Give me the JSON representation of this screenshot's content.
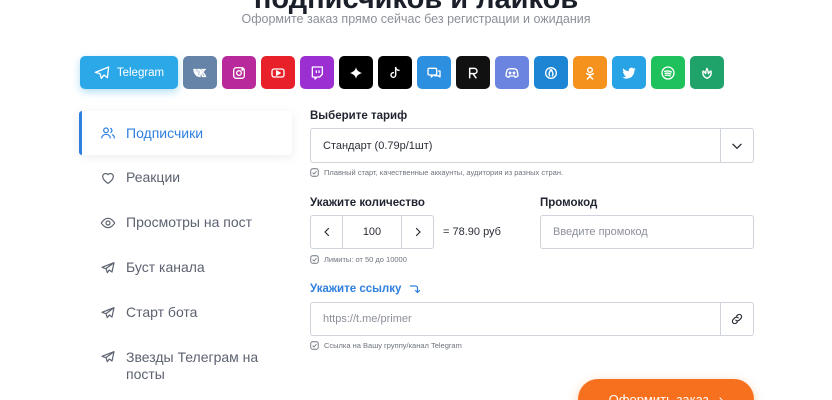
{
  "hero": {
    "title": "подписчиков и лайков",
    "subtitle": "Оформите заказ прямо сейчас без регистрации и ожидания"
  },
  "platforms": {
    "active_label": "Telegram",
    "items": [
      {
        "name": "Telegram",
        "icon": "telegram-icon",
        "color": "#2aa8e8"
      },
      {
        "name": "VK",
        "icon": "vk-icon",
        "color": "#6683a8"
      },
      {
        "name": "Instagram",
        "icon": "instagram-icon",
        "color": "#b82a9c"
      },
      {
        "name": "YouTube",
        "icon": "youtube-icon",
        "color": "#e8202a"
      },
      {
        "name": "Twitch",
        "icon": "twitch-icon",
        "color": "#9b2fd2"
      },
      {
        "name": "Threads",
        "icon": "sparkle-icon",
        "color": "#000000"
      },
      {
        "name": "TikTok",
        "icon": "tiktok-icon",
        "color": "#000000"
      },
      {
        "name": "Chat",
        "icon": "chat-icon",
        "color": "#2d8fe0"
      },
      {
        "name": "Rutube",
        "icon": "rutube-icon",
        "color": "#111111"
      },
      {
        "name": "Discord",
        "icon": "discord-icon",
        "color": "#6b84e0"
      },
      {
        "name": "Likee",
        "icon": "swirl-icon",
        "color": "#1d86d4"
      },
      {
        "name": "Odnoklassniki",
        "icon": "ok-icon",
        "color": "#f5921e"
      },
      {
        "name": "Twitter",
        "icon": "twitter-icon",
        "color": "#27a3e6"
      },
      {
        "name": "Spotify",
        "icon": "spotify-icon",
        "color": "#1ec15b"
      },
      {
        "name": "Other",
        "icon": "leaf-icon",
        "color": "#1fa36a"
      }
    ]
  },
  "sidebar": {
    "items": [
      {
        "label": "Подписчики",
        "icon": "users-icon",
        "active": true
      },
      {
        "label": "Реакции",
        "icon": "heart-icon",
        "active": false
      },
      {
        "label": "Просмотры на пост",
        "icon": "eye-icon",
        "active": false
      },
      {
        "label": "Буст канала",
        "icon": "send-icon",
        "active": false
      },
      {
        "label": "Старт бота",
        "icon": "send-icon",
        "active": false
      },
      {
        "label": "Звезды Телеграм на посты",
        "icon": "send-icon",
        "active": false
      }
    ]
  },
  "form": {
    "tariff_label": "Выберите тариф",
    "tariff_value": "Стандарт (0.79р/1шт)",
    "tariff_hint": "Плавный старт, качественные аккаунты, аудитория из разных стран.",
    "quantity_label": "Укажите количество",
    "quantity_value": "100",
    "price_text": "= 78.90 руб",
    "quantity_hint": "Лимиты: от 50 до 10000",
    "promo_label": "Промокод",
    "promo_placeholder": "Введите промокод",
    "link_label": "Укажите ссылку",
    "link_placeholder": "https://t.me/primer",
    "link_hint": "Ссылка на Вашу группу/канал Telegram",
    "submit_label": "Оформить заказ"
  },
  "colors": {
    "accent": "#2f7fdf",
    "submit": "#f7701e"
  }
}
